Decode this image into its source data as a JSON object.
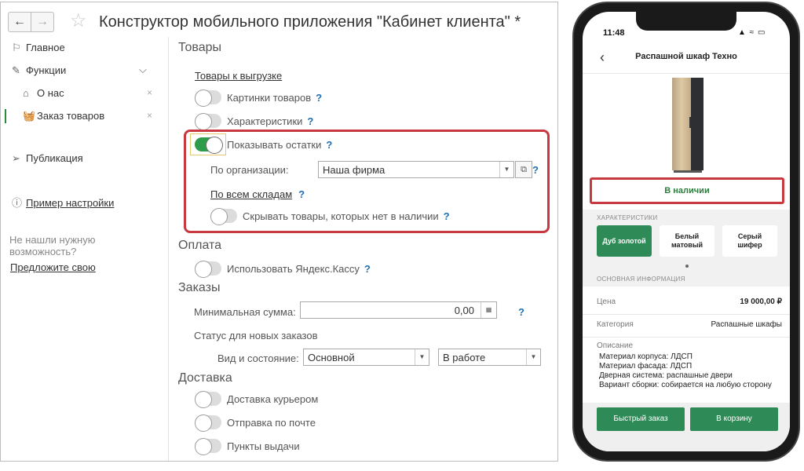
{
  "window": {
    "title": "Конструктор мобильного приложения \"Кабинет клиента\" *",
    "back_glyph": "←",
    "forward_glyph": "→",
    "star_glyph": "☆"
  },
  "sidebar": {
    "main": "Главное",
    "functions": "Функции",
    "about": "О нас",
    "orders": "Заказ товаров",
    "publication": "Публикация",
    "example": "Пример настройки",
    "hint": "Не нашли нужную возможность?",
    "suggest": "Предложите свою",
    "close_glyph": "×",
    "chevron_glyph": "⌵"
  },
  "content": {
    "goods": {
      "title": "Товары",
      "export_link": "Товары к выгрузке",
      "pictures": {
        "label": "Картинки товаров",
        "on": false
      },
      "characteristics": {
        "label": "Характеристики",
        "on": false
      },
      "show_stock": {
        "label": "Показывать остатки",
        "on": true
      },
      "by_org_label": "По организации:",
      "org_value": "Наша фирма",
      "all_warehouses": "По всем складам",
      "hide_absent": {
        "label": "Скрывать товары, которых нет в наличии",
        "on": false
      }
    },
    "payment": {
      "title": "Оплата",
      "yandex": {
        "label": "Использовать Яндекс.Кассу",
        "on": false
      }
    },
    "orders": {
      "title": "Заказы",
      "min_sum_label": "Минимальная сумма:",
      "min_sum_value": "0,00",
      "status_label": "Статус для новых заказов",
      "kind_label": "Вид и состояние:",
      "kind_value": "Основной",
      "state_value": "В работе"
    },
    "delivery": {
      "title": "Доставка",
      "courier": {
        "label": "Доставка курьером",
        "on": false
      },
      "mail": {
        "label": "Отправка по почте",
        "on": false
      },
      "pickup": {
        "label": "Пункты выдачи",
        "on": false
      }
    },
    "help_glyph": "?"
  },
  "phone": {
    "time": "11:48",
    "status_icons": "▲ ≈ ▭",
    "title": "Распашной шкаф Техно",
    "availability": "В наличии",
    "characteristics_label": "ХАРАКТЕРИСТИКИ",
    "options": [
      "Дуб золотой",
      "Белый матовый",
      "Серый шифер"
    ],
    "selected_option": 0,
    "info_label": "ОСНОВНАЯ ИНФОРМАЦИЯ",
    "price_label": "Цена",
    "price_value": "19 000,00 ₽",
    "category_label": "Категория",
    "category_value": "Распашные шкафы",
    "description_label": "Описание",
    "description_lines": [
      "Материал корпуса: ЛДСП",
      "Материал фасада: ЛДСП",
      "Дверная система: распашные двери",
      "Вариант сборки: собирается на любую сторону"
    ],
    "quick_order": "Быстрый заказ",
    "to_cart": "В корзину"
  },
  "colors": {
    "accent_green": "#2e8b57",
    "toggle_on": "#2e9d4b",
    "highlight_red": "#c8393f",
    "link_blue": "#1f6fb5"
  }
}
